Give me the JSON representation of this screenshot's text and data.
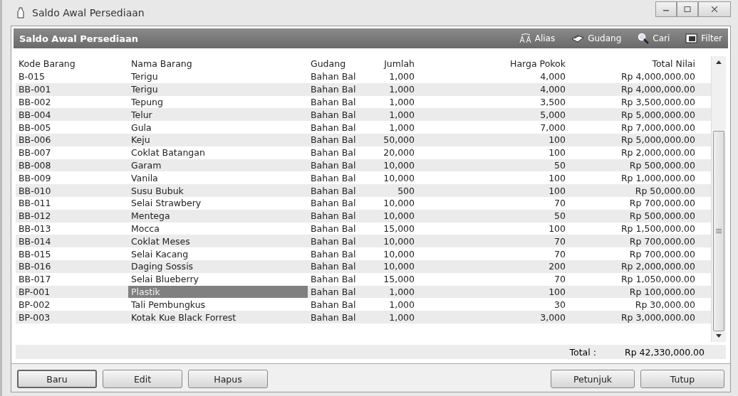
{
  "window": {
    "title": "Saldo Awal Persediaan"
  },
  "panel": {
    "title": "Saldo Awal Persediaan"
  },
  "toolbar": [
    {
      "label": "Alias",
      "kind": "alias"
    },
    {
      "label": "Gudang",
      "kind": "gudang"
    },
    {
      "label": "Cari",
      "kind": "cari"
    },
    {
      "label": "Filter",
      "kind": "filter"
    }
  ],
  "table": {
    "columns": [
      "Kode Barang",
      "Nama Barang",
      "Gudang",
      "Jumlah",
      "Harga Pokok",
      "Total Nilai"
    ],
    "rows": [
      {
        "cells": [
          "B-015",
          "Terigu",
          "Bahan Bal",
          "1,000",
          "4,000",
          "Rp 4,000,000.00"
        ],
        "selected": false
      },
      {
        "cells": [
          "BB-001",
          "Terigu",
          "Bahan Bal",
          "1,000",
          "4,000",
          "Rp 4,000,000.00"
        ],
        "selected": false
      },
      {
        "cells": [
          "BB-002",
          "Tepung",
          "Bahan Bal",
          "1,000",
          "3,500",
          "Rp 3,500,000.00"
        ],
        "selected": false
      },
      {
        "cells": [
          "BB-004",
          "Telur",
          "Bahan Bal",
          "1,000",
          "5,000",
          "Rp 5,000,000.00"
        ],
        "selected": false
      },
      {
        "cells": [
          "BB-005",
          "Gula",
          "Bahan Bal",
          "1,000",
          "7,000",
          "Rp 7,000,000.00"
        ],
        "selected": false
      },
      {
        "cells": [
          "BB-006",
          "Keju",
          "Bahan Bal",
          "50,000",
          "100",
          "Rp 5,000,000.00"
        ],
        "selected": false
      },
      {
        "cells": [
          "BB-007",
          "Coklat Batangan",
          "Bahan Bal",
          "20,000",
          "100",
          "Rp 2,000,000.00"
        ],
        "selected": false
      },
      {
        "cells": [
          "BB-008",
          "Garam",
          "Bahan Bal",
          "10,000",
          "50",
          "Rp 500,000.00"
        ],
        "selected": false
      },
      {
        "cells": [
          "BB-009",
          "Vanila",
          "Bahan Bal",
          "10,000",
          "100",
          "Rp 1,000,000.00"
        ],
        "selected": false
      },
      {
        "cells": [
          "BB-010",
          "Susu Bubuk",
          "Bahan Bal",
          "500",
          "100",
          "Rp 50,000.00"
        ],
        "selected": false
      },
      {
        "cells": [
          "BB-011",
          "Selai Strawbery",
          "Bahan Bal",
          "10,000",
          "70",
          "Rp 700,000.00"
        ],
        "selected": false
      },
      {
        "cells": [
          "BB-012",
          "Mentega",
          "Bahan Bal",
          "10,000",
          "50",
          "Rp 500,000.00"
        ],
        "selected": false
      },
      {
        "cells": [
          "BB-013",
          "Mocca",
          "Bahan Bal",
          "15,000",
          "100",
          "Rp 1,500,000.00"
        ],
        "selected": false
      },
      {
        "cells": [
          "BB-014",
          "Coklat Meses",
          "Bahan Bal",
          "10,000",
          "70",
          "Rp 700,000.00"
        ],
        "selected": false
      },
      {
        "cells": [
          "BB-015",
          "Selai Kacang",
          "Bahan Bal",
          "10,000",
          "70",
          "Rp 700,000.00"
        ],
        "selected": false
      },
      {
        "cells": [
          "BB-016",
          "Daging Sossis",
          "Bahan Bal",
          "10,000",
          "200",
          "Rp 2,000,000.00"
        ],
        "selected": false
      },
      {
        "cells": [
          "BB-017",
          "Selai Blueberry",
          "Bahan Bal",
          "15,000",
          "70",
          "Rp 1,050,000.00"
        ],
        "selected": false
      },
      {
        "cells": [
          "BP-001",
          "Plastik",
          "Bahan Bal",
          "1,000",
          "100",
          "Rp 100,000.00"
        ],
        "selected": true
      },
      {
        "cells": [
          "BP-002",
          "Tali Pembungkus",
          "Bahan Bal",
          "1,000",
          "30",
          "Rp 30,000.00"
        ],
        "selected": false
      },
      {
        "cells": [
          "BP-003",
          "Kotak Kue Black Forrest",
          "Bahan Bal",
          "1,000",
          "3,000",
          "Rp 3,000,000.00"
        ],
        "selected": false
      }
    ]
  },
  "total": {
    "label": "Total :",
    "value": "Rp 42,330,000.00"
  },
  "buttons_left": [
    "Baru",
    "Edit",
    "Hapus"
  ],
  "buttons_right": [
    "Petunjuk",
    "Tutup"
  ]
}
